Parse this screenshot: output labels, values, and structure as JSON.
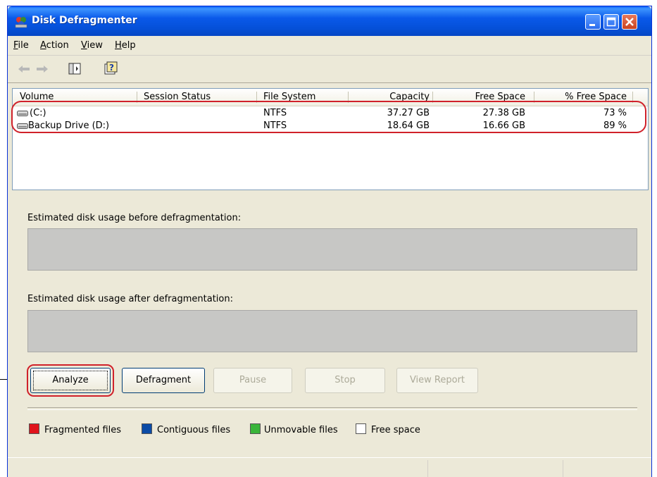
{
  "window": {
    "title": "Disk Defragmenter",
    "controls": {
      "minimize": "minimize",
      "maximize": "maximize",
      "close": "close"
    }
  },
  "menu": {
    "items": [
      {
        "accel": "F",
        "rest": "ile"
      },
      {
        "accel": "A",
        "rest": "ction"
      },
      {
        "accel": "V",
        "rest": "iew"
      },
      {
        "accel": "H",
        "rest": "elp"
      }
    ]
  },
  "toolbar": {
    "icons": [
      "back-arrow-icon",
      "forward-arrow-icon",
      "show-hide-tree-icon",
      "help-icon"
    ]
  },
  "volumes": {
    "columns": [
      "Volume",
      "Session Status",
      "File System",
      "Capacity",
      "Free Space",
      "% Free Space"
    ],
    "rows": [
      {
        "volume": "(C:)",
        "status": "",
        "fs": "NTFS",
        "capacity": "37.27 GB",
        "free": "27.38 GB",
        "pct": "73 %",
        "selected": true
      },
      {
        "volume": "Backup Drive (D:)",
        "status": "",
        "fs": "NTFS",
        "capacity": "18.64 GB",
        "free": "16.66 GB",
        "pct": "89 %",
        "selected": false
      }
    ]
  },
  "usage": {
    "before_label": "Estimated disk usage before defragmentation:",
    "after_label": "Estimated disk usage after defragmentation:"
  },
  "buttons": {
    "analyze": "Analyze",
    "defragment": "Defragment",
    "pause": "Pause",
    "stop": "Stop",
    "view_report": "View Report"
  },
  "legend": {
    "items": [
      {
        "label": "Fragmented files",
        "color": "#e0141c"
      },
      {
        "label": "Contiguous files",
        "color": "#0b4ba6"
      },
      {
        "label": "Unmovable files",
        "color": "#3ab53a"
      },
      {
        "label": "Free space",
        "color": "#ffffff"
      }
    ]
  }
}
